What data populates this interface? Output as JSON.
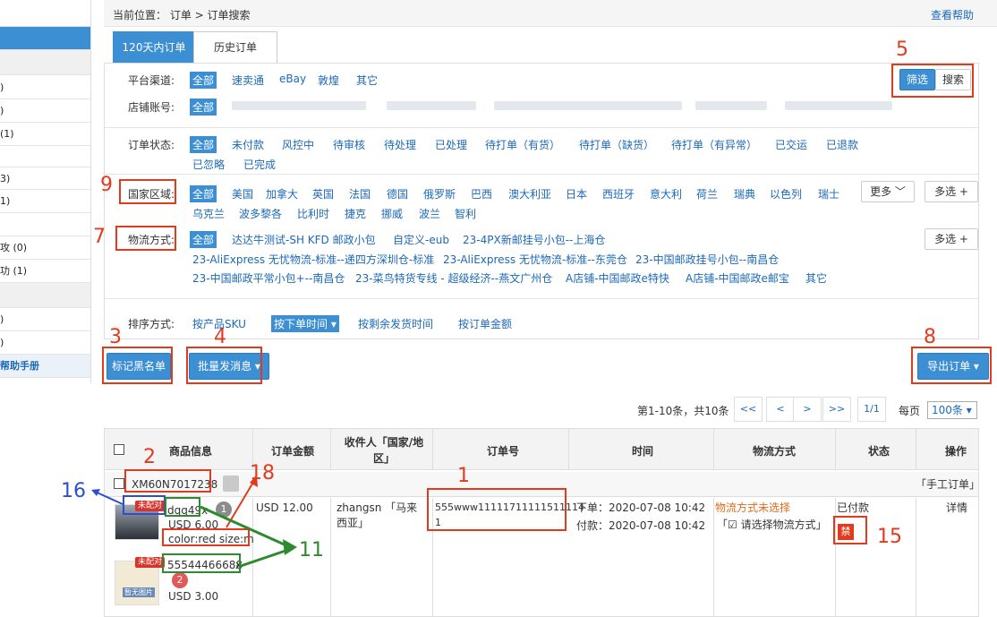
{
  "sidebar": {
    "rows": [
      {
        "text": "",
        "kind": "blank"
      },
      {
        "text": "",
        "kind": "active"
      },
      {
        "text": "",
        "kind": "hdr"
      },
      {
        "text": ")",
        "kind": "item"
      },
      {
        "text": ")",
        "kind": "item"
      },
      {
        "text": "  (1)",
        "kind": "item"
      },
      {
        "text": "",
        "kind": "item"
      },
      {
        "text": "3)",
        "kind": "item"
      },
      {
        "text": "1)",
        "kind": "item"
      },
      {
        "text": "",
        "kind": "item"
      },
      {
        "text": "攻  (0)",
        "kind": "item"
      },
      {
        "text": "功  (1)",
        "kind": "item"
      },
      {
        "text": "",
        "kind": "hdr"
      },
      {
        "text": ")",
        "kind": "item"
      },
      {
        "text": ")",
        "kind": "item"
      },
      {
        "text": "帮助手册",
        "kind": "link"
      }
    ]
  },
  "header": {
    "breadcrumb": "当前位置：  订单 > 订单搜索",
    "help": "查看帮助"
  },
  "tabs": [
    "120天内订单",
    "历史订单"
  ],
  "filters": {
    "platform_label": "平台渠道:",
    "platform_options": [
      "全部",
      "速卖通",
      "eBay",
      "敦煌",
      "其它"
    ],
    "store_label": "店铺账号:",
    "store_all": "全部",
    "filter_btn": "筛选",
    "search_btn": "搜索",
    "status_label": "订单状态:",
    "status_row1": [
      "全部",
      "未付款",
      "风控中",
      "待审核",
      "待处理",
      "已处理",
      "待打单（有货）",
      "待打单（缺货）",
      "待打单（有异常）",
      "已交运",
      "已退款"
    ],
    "status_row2": [
      "已忽略",
      "已完成"
    ],
    "country_label": "国家区域:",
    "country_row1": [
      "全部",
      "美国",
      "加拿大",
      "英国",
      "法国",
      "德国",
      "俄罗斯",
      "巴西",
      "澳大利亚",
      "日本",
      "西班牙",
      "意大利",
      "荷兰",
      "瑞典",
      "以色列",
      "瑞士"
    ],
    "country_row2": [
      "乌克兰",
      "波多黎各",
      "比利时",
      "捷克",
      "挪威",
      "波兰",
      "智利"
    ],
    "more_btn": "更多",
    "multi_btn": "多选 +",
    "shipping_label": "物流方式:",
    "shipping_row1": [
      "全部",
      "达达牛测试-SH KFD 邮政小包",
      "自定义-eub",
      "23-4PX新邮挂号小包--上海仓"
    ],
    "shipping_row2": [
      "23-AliExpress 无忧物流-标准--递四方深圳仓-标准",
      "23-AliExpress 无忧物流-标准--东莞仓",
      "23-中国邮政挂号小包--南昌仓"
    ],
    "shipping_row3": [
      "23-中国邮政平常小包+--南昌仓",
      "23-菜鸟特货专线 - 超级经济--燕文广州仓",
      "A店铺-中国邮政e特快",
      "A店铺-中国邮政e邮宝",
      "其它"
    ],
    "sort_label": "排序方式:",
    "sort_options": [
      "按产品SKU",
      "按下单时间 ▾",
      "按剩余发货时间",
      "按订单金额"
    ]
  },
  "actions": {
    "blacklist": "标记黑名单",
    "batch_msg": "批量发消息 ▾",
    "export": "导出订单 ▾"
  },
  "pager": {
    "summary": "第1-10条，共10条",
    "first": "<<",
    "prev": "<",
    "next": ">",
    "last": ">>",
    "page": "1/1",
    "per_page_label": "每页",
    "per_page_value": "100条 ▾"
  },
  "table": {
    "headers": [
      "商品信息",
      "订单金额",
      "收件人「国家/地区」",
      "订单号",
      "时间",
      "物流方式",
      "状态",
      "操作"
    ],
    "order": {
      "order_id": "XM60N7017238",
      "source": "「手工订单」",
      "item1_tag": "未配对",
      "item1_sku": "dqq49",
      "item1_qty": "x",
      "item1_price": "USD 6.00",
      "item1_attr": "color:red size:m",
      "item2_tag": "未配对",
      "item2_sku": "55544466688",
      "item2_qty": "x",
      "item2_price": "USD 3.00",
      "item2_noimg": "暂无图片",
      "badge1": "1",
      "badge2": "2",
      "amount": "USD 12.00",
      "recipient_line1": "zhangsn  「马来",
      "recipient_line2": "西亚」",
      "order_no_line1": "555www11111711111511114",
      "order_no_line2": "1",
      "time_order": "下单：2020-07-08 10:42",
      "time_paid": "付款：2020-07-08 10:42",
      "shipping_status": "物流方式未选择",
      "shipping_choose": "「☑ 请选择物流方式」",
      "status": "已付款",
      "ban": "禁",
      "detail": "详情"
    }
  },
  "annotations": {
    "n1": "1",
    "n2": "2",
    "n3": "3",
    "n4": "4",
    "n5": "5",
    "n7": "7",
    "n8": "8",
    "n9": "9",
    "n11": "11",
    "n15": "15",
    "n16": "16",
    "n18": "18"
  },
  "colors": {
    "accent": "#3d8fd3",
    "link": "#1c69b8",
    "annotation_red": "#e23a1d",
    "annotation_blue": "#2d4fcf",
    "annotation_green": "#2e8a2e"
  }
}
